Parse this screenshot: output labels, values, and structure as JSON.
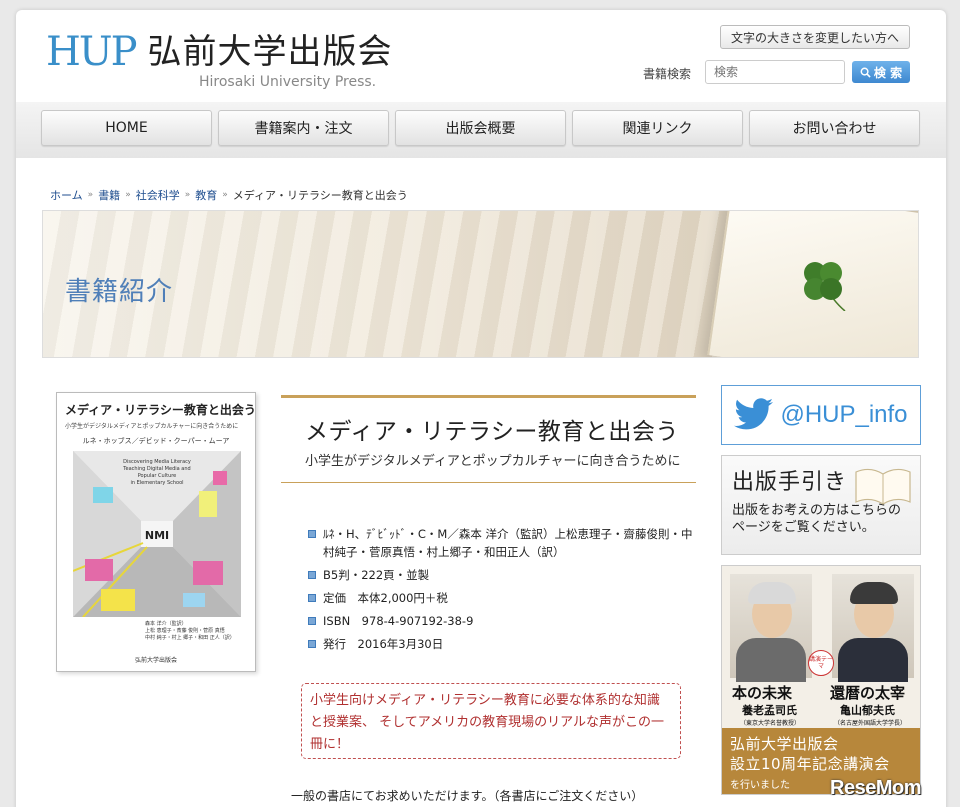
{
  "site": {
    "logo_mark": "HUP",
    "title": "弘前大学出版会",
    "subtitle": "Hirosaki University Press."
  },
  "header": {
    "font_size_button": "文字の大きさを変更したい方へ",
    "search_label": "書籍検索",
    "search_placeholder": "検索",
    "search_button": "検 索"
  },
  "nav": {
    "items": [
      {
        "label": "HOME"
      },
      {
        "label": "書籍案内・注文"
      },
      {
        "label": "出版会概要"
      },
      {
        "label": "関連リンク"
      },
      {
        "label": "お問い合わせ"
      }
    ]
  },
  "breadcrumb": {
    "items": [
      "ホーム",
      "書籍",
      "社会科学",
      "教育"
    ],
    "current": "メディア・リテラシー教育と出会う"
  },
  "hero": {
    "title": "書籍紹介"
  },
  "cover": {
    "title": "メディア・リテラシー教育と出会う",
    "subtitle": "小学生がデジタルメディアとポップカルチャーに向き合うために",
    "authors": "ルネ・ホッブス／デビッド・クーパー・ムーア",
    "english_lines": [
      "Discovering Media Literacy",
      "Teaching Digital Media and",
      "Popular Culture",
      "in Elementary School"
    ],
    "editors_lines": [
      "森本 洋介（監訳）",
      "上松 恵理子・斎藤 俊則・菅原 真悟",
      "中村 純子・村上 郷子・和田 正人（訳）"
    ],
    "publisher": "弘前大学出版会"
  },
  "book": {
    "title": "メディア・リテラシー教育と出会う",
    "subtitle": "小学生がデジタルメディアとポップカルチャーに向き合うために",
    "details": [
      "ﾙﾈ・H、ﾃﾞﾋﾞｯﾄﾞ・C・M／森本 洋介（監訳）上松恵理子・齋藤俊則・中村純子・菅原真悟・村上郷子・和田正人（訳）",
      "B5判・222頁・並製",
      "定価　本体2,000円＋税",
      "ISBN　978-4-907192-38-9",
      "発行　2016年3月30日"
    ],
    "promo": "小学生向けメディア・リテラシー教育に必要な体系的な知識と授業案、 そしてアメリカの教育現場のリアルな声がこの一冊に！",
    "note": "一般の書店にてお求めいただけます。（各書店にご注文ください）"
  },
  "sidebar": {
    "twitter_handle": "@HUP_info",
    "guide_title": "出版手引き",
    "guide_text": "出版をお考えの方はこちらのページをご覧ください。",
    "lecture": {
      "theme_badge": "講演テーマ",
      "left_title": "本の未来",
      "left_speaker": "養老孟司氏",
      "left_affil": "（東京大学名誉教授）",
      "right_title": "還暦の太宰",
      "right_speaker": "亀山郁夫氏",
      "right_affil": "（名古屋外国語大学学長）",
      "banner_title_1": "弘前大学出版会",
      "banner_title_2": "設立10周年記念講演会",
      "banner_sub": "を行いました"
    }
  },
  "watermark": "ReseMom",
  "colors": {
    "accent_blue": "#3a8fc9",
    "gold": "#c9a15a",
    "promo_red": "#b03030",
    "lecture_banner": "#b7873b"
  }
}
